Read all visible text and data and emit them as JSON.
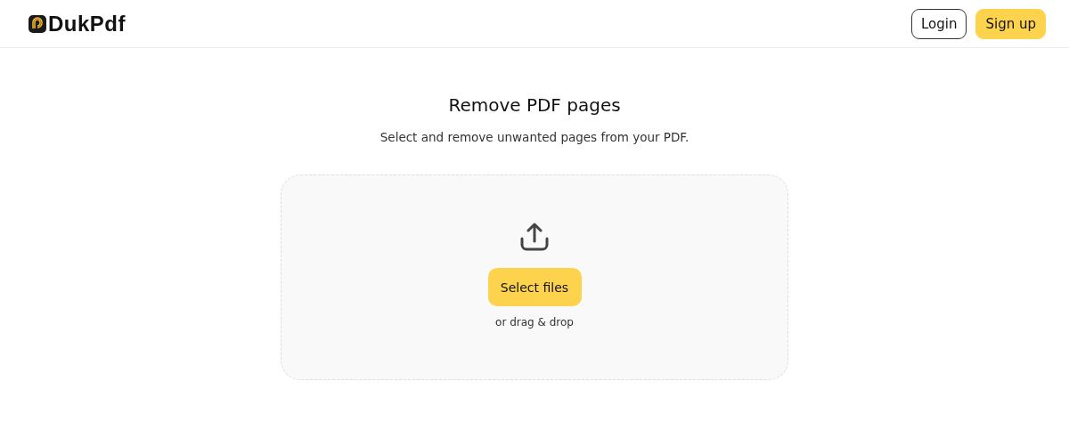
{
  "header": {
    "logo": "DukPdf",
    "buttons": [
      {
        "label": "Login",
        "kind": "outline"
      },
      {
        "label": "Sign up",
        "kind": "primary"
      }
    ]
  },
  "main": {
    "title": "Remove PDF pages",
    "subtitle": "Select and remove unwanted pages from your PDF.",
    "dropzone": {
      "button": "Select files",
      "hint": "or drag & drop"
    }
  }
}
